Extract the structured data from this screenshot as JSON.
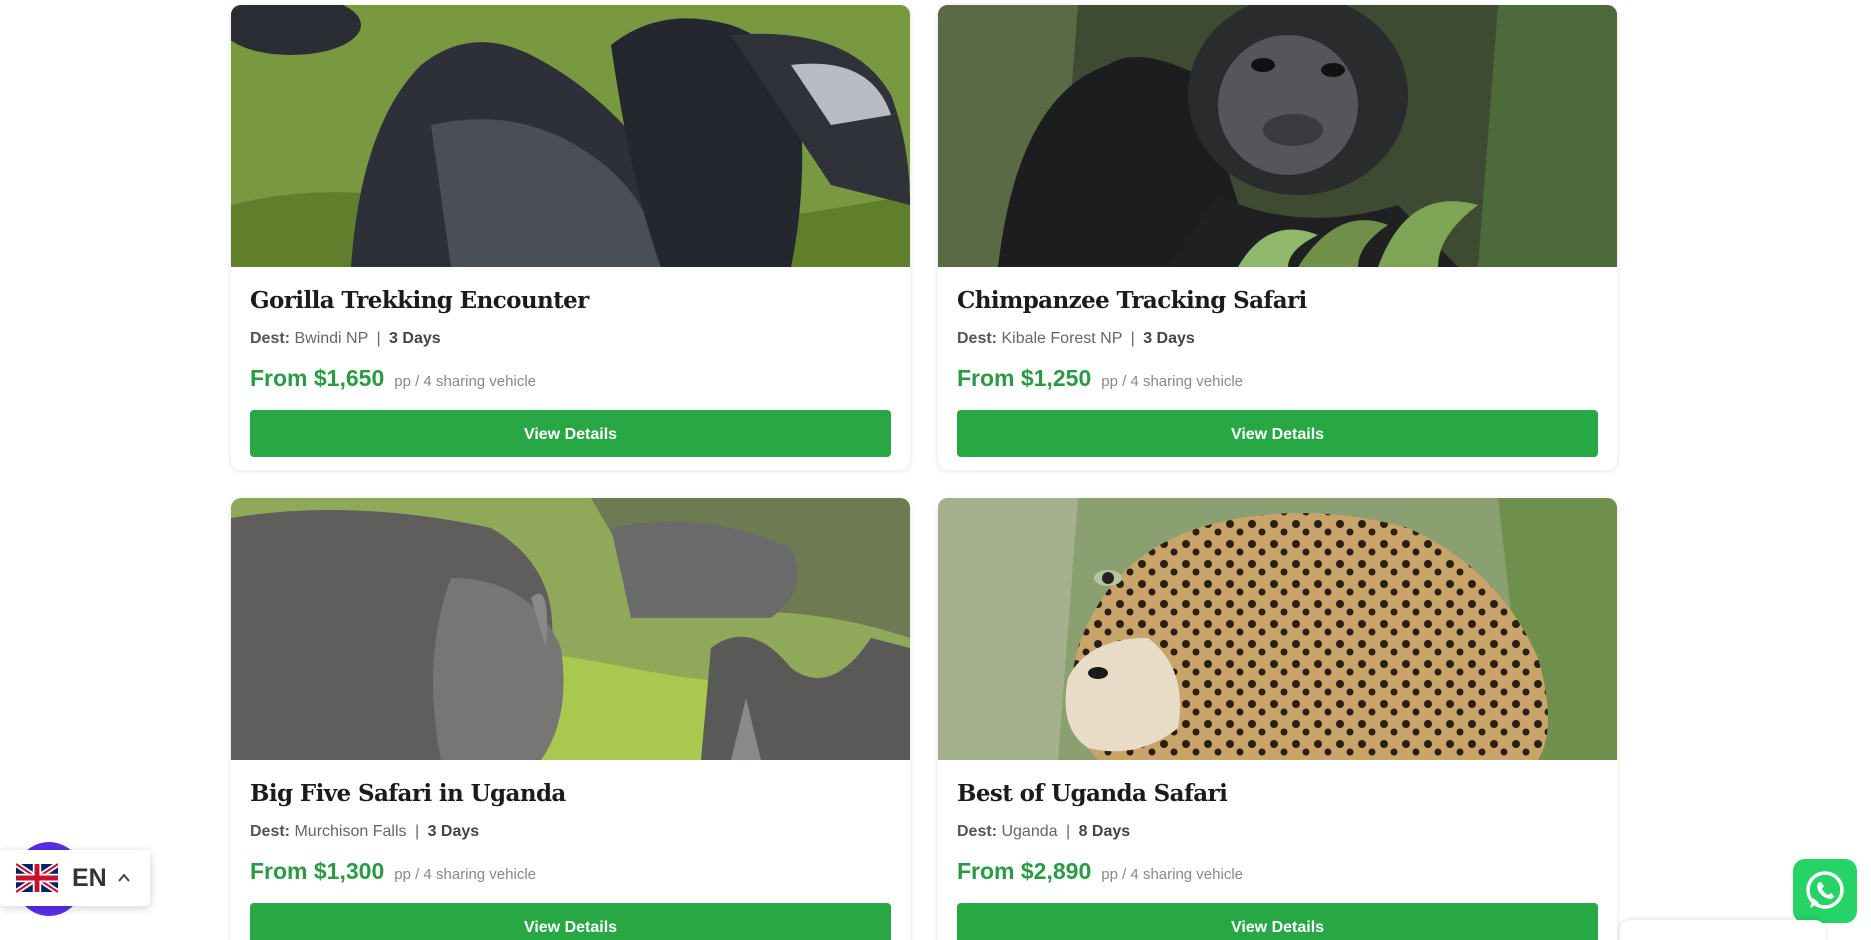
{
  "tours": [
    {
      "title": "Gorilla Trekking Encounter",
      "dest_label": "Dest:",
      "destination": "Bwindi NP",
      "separator": "|",
      "duration": "3 Days",
      "price": "From $1,650",
      "price_note": "pp / 4 sharing vehicle",
      "button_label": "View Details",
      "image_subject": "gorillas"
    },
    {
      "title": "Chimpanzee Tracking Safari",
      "dest_label": "Dest:",
      "destination": "Kibale Forest NP",
      "separator": "|",
      "duration": "3 Days",
      "price": "From $1,250",
      "price_note": "pp / 4 sharing vehicle",
      "button_label": "View Details",
      "image_subject": "chimpanzee"
    },
    {
      "title": "Big Five Safari in Uganda",
      "dest_label": "Dest:",
      "destination": "Murchison Falls",
      "separator": "|",
      "duration": "3 Days",
      "price": "From $1,300",
      "price_note": "pp / 4 sharing vehicle",
      "button_label": "View Details",
      "image_subject": "rhinoceros"
    },
    {
      "title": "Best of Uganda Safari",
      "dest_label": "Dest:",
      "destination": "Uganda",
      "separator": "|",
      "duration": "8 Days",
      "price": "From $2,890",
      "price_note": "pp / 4 sharing vehicle",
      "button_label": "View Details",
      "image_subject": "leopard"
    }
  ],
  "language": {
    "code": "EN",
    "flag_icon": "uk-flag-icon",
    "chevron_icon": "chevron-up-icon"
  },
  "whatsapp": {
    "icon": "whatsapp-icon"
  },
  "colors": {
    "accent_green": "#28a745",
    "price_green": "#2a9a45",
    "whatsapp_green": "#25d366",
    "language_bubble": "#5a2ee6"
  }
}
